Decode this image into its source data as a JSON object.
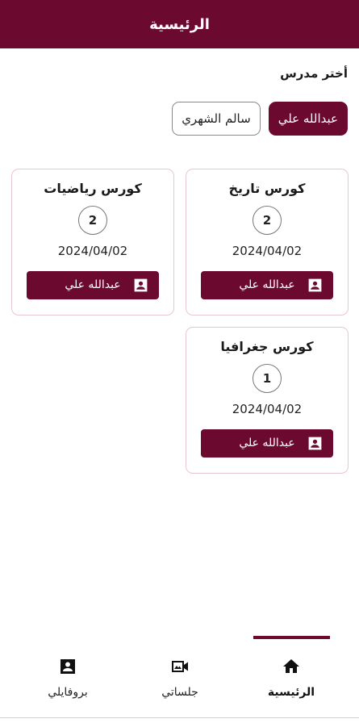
{
  "appbar": {
    "title": "الرئيسية"
  },
  "teacher_section": {
    "label": "أختر مدرس",
    "chips": [
      {
        "label": "عبدالله علي",
        "selected": true
      },
      {
        "label": "سالم الشهري",
        "selected": false
      }
    ]
  },
  "courses": [
    {
      "title": "كورس تاريخ",
      "count": "2",
      "date": "2024/04/02",
      "teacher": "عبدالله علي"
    },
    {
      "title": "كورس رياضيات",
      "count": "2",
      "date": "2024/04/02",
      "teacher": "عبدالله علي"
    },
    {
      "title": "كورس جغرافيا",
      "count": "1",
      "date": "2024/04/02",
      "teacher": "عبدالله علي"
    }
  ],
  "bottom_nav": {
    "items": [
      {
        "label": "الرئيسية",
        "icon": "home-icon",
        "active": true
      },
      {
        "label": "جلساتي",
        "icon": "video-camera-icon",
        "active": false
      },
      {
        "label": "بروفايلي",
        "icon": "profile-icon",
        "active": false
      }
    ]
  },
  "colors": {
    "primary": "#6b0a2e",
    "card_border": "#e7c6cf"
  }
}
